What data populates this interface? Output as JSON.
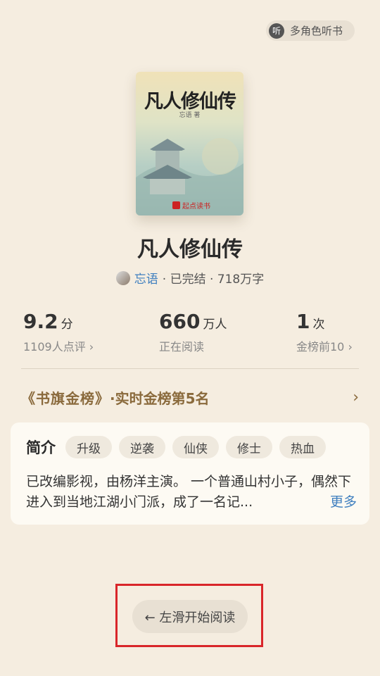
{
  "header": {
    "listen_label": "多角色听书",
    "listen_icon": "听"
  },
  "cover": {
    "title_art": "凡人修仙传",
    "author": "忘语 著",
    "logo_text": "起点读书",
    "logo_mark": "起"
  },
  "book": {
    "title": "凡人修仙传",
    "author": "忘语",
    "status": "· 已完结 · 718万字"
  },
  "stats": [
    {
      "value": "9.2",
      "unit": "分",
      "sub": "1109人点评 ›"
    },
    {
      "value": "660",
      "unit": "万人",
      "sub": "正在阅读"
    },
    {
      "value": "1",
      "unit": "次",
      "sub": "金榜前10 ›"
    }
  ],
  "rank": {
    "badge": "《书旗金榜》",
    "text": "·实时金榜第5名",
    "chevron": "›"
  },
  "intro": {
    "label": "简介",
    "tags": [
      "升级",
      "逆袭",
      "仙侠",
      "修士",
      "热血"
    ],
    "text": "已改编影视，由杨洋主演。 一个普通山村小子，偶然下进入到当地江湖小门派，成了一名记...",
    "more": "更多"
  },
  "start": {
    "label": "← 左滑开始阅读"
  }
}
